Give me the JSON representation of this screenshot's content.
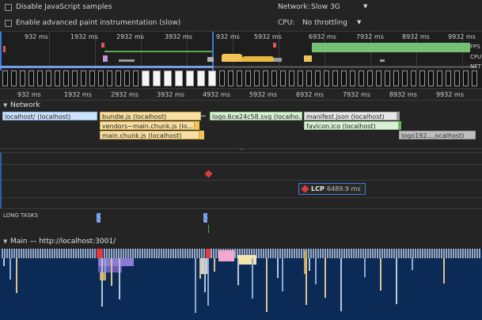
{
  "settings": {
    "disable_js_samples": "Disable JavaScript samples",
    "enable_paint": "Enable advanced paint instrumentation (slow)",
    "network_label": "Network:",
    "network_value": "Slow 3G",
    "cpu_label": "CPU:",
    "cpu_value": "No throttling"
  },
  "overview": {
    "ticks": [
      "932 ms",
      "1932 ms",
      "2932 ms",
      "3932 ms",
      "932 ms",
      "5932 ms",
      "6932 ms",
      "7932 ms",
      "8932 ms",
      "9932 ms"
    ],
    "lane_labels": {
      "fps": "FPS",
      "cpu": "CPU",
      "net": "NET"
    }
  },
  "ruler": {
    "ticks": [
      "932 ms",
      "1932 ms",
      "2932 ms",
      "3932 ms",
      "4932 ms",
      "5932 ms",
      "6932 ms",
      "7932 ms",
      "8932 ms",
      "9932 ms"
    ]
  },
  "network": {
    "title": "Network",
    "requests": [
      {
        "label": "localhost/ (localhost)"
      },
      {
        "label": "bundle.js (localhost)"
      },
      {
        "label": "vendors~main.chunk.js (lo..."
      },
      {
        "label": "main.chunk.js (localhost)"
      },
      {
        "label": "logo.6ce24c58.svg (localho..."
      },
      {
        "label": "manifest.json (localhost)"
      },
      {
        "label": "favicon.ico (localhost)"
      },
      {
        "label": "logo192....ocalhost)"
      }
    ]
  },
  "timings": {
    "lcp_label": "LCP",
    "lcp_value": "6489.9 ms"
  },
  "long_tasks": {
    "title": "LONG TASKS"
  },
  "main": {
    "title": "Main — http://localhost:3001/"
  },
  "colors": {
    "doc": "#cfe2fb",
    "script": "#f7dfa4",
    "image": "#d8f0d4",
    "other": "#e6e6e6",
    "main_bg": "#0b2a56",
    "lcp": "#e0393e"
  }
}
